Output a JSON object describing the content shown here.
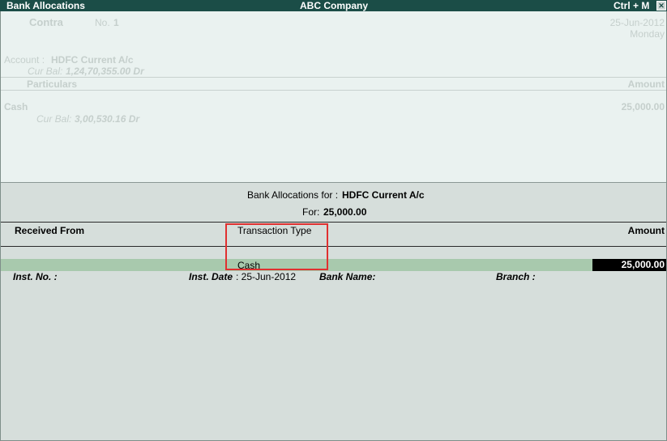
{
  "title_bar": {
    "left": "Bank Allocations",
    "center": "ABC Company",
    "shortcut": "Ctrl + M",
    "close": "✕"
  },
  "voucher": {
    "type": "Contra",
    "no_label": "No.",
    "no_value": "1",
    "date": "25-Jun-2012",
    "day": "Monday",
    "account_label": "Account :",
    "account_value": "HDFC Current A/c",
    "account_cur_bal_label": "Cur Bal:",
    "account_cur_bal_value": "1,24,70,355.00 Dr",
    "col_particulars": "Particulars",
    "col_amount": "Amount",
    "entry_name": "Cash",
    "entry_amount": "25,000.00",
    "entry_cur_bal_label": "Cur Bal:",
    "entry_cur_bal_value": "3,00,530.16 Dr"
  },
  "allocation": {
    "header_label": "Bank Allocations for :",
    "header_value": "HDFC Current A/c",
    "for_label": "For:",
    "for_value": "25,000.00",
    "col_received_from": "Received From",
    "col_transaction_type": "Transaction Type",
    "col_amount": "Amount",
    "row_transaction_type": "Cash",
    "row_amount": "25,000.00",
    "inst_no_label": "Inst. No. :",
    "inst_date_label": "Inst. Date",
    "inst_date_value": ": 25-Jun-2012",
    "bank_name_label": "Bank Name:",
    "branch_label": "Branch :"
  },
  "colors": {
    "title_bar": "#1b4d47",
    "selected_row": "#a8c9ad",
    "highlight_box": "#e03030"
  }
}
